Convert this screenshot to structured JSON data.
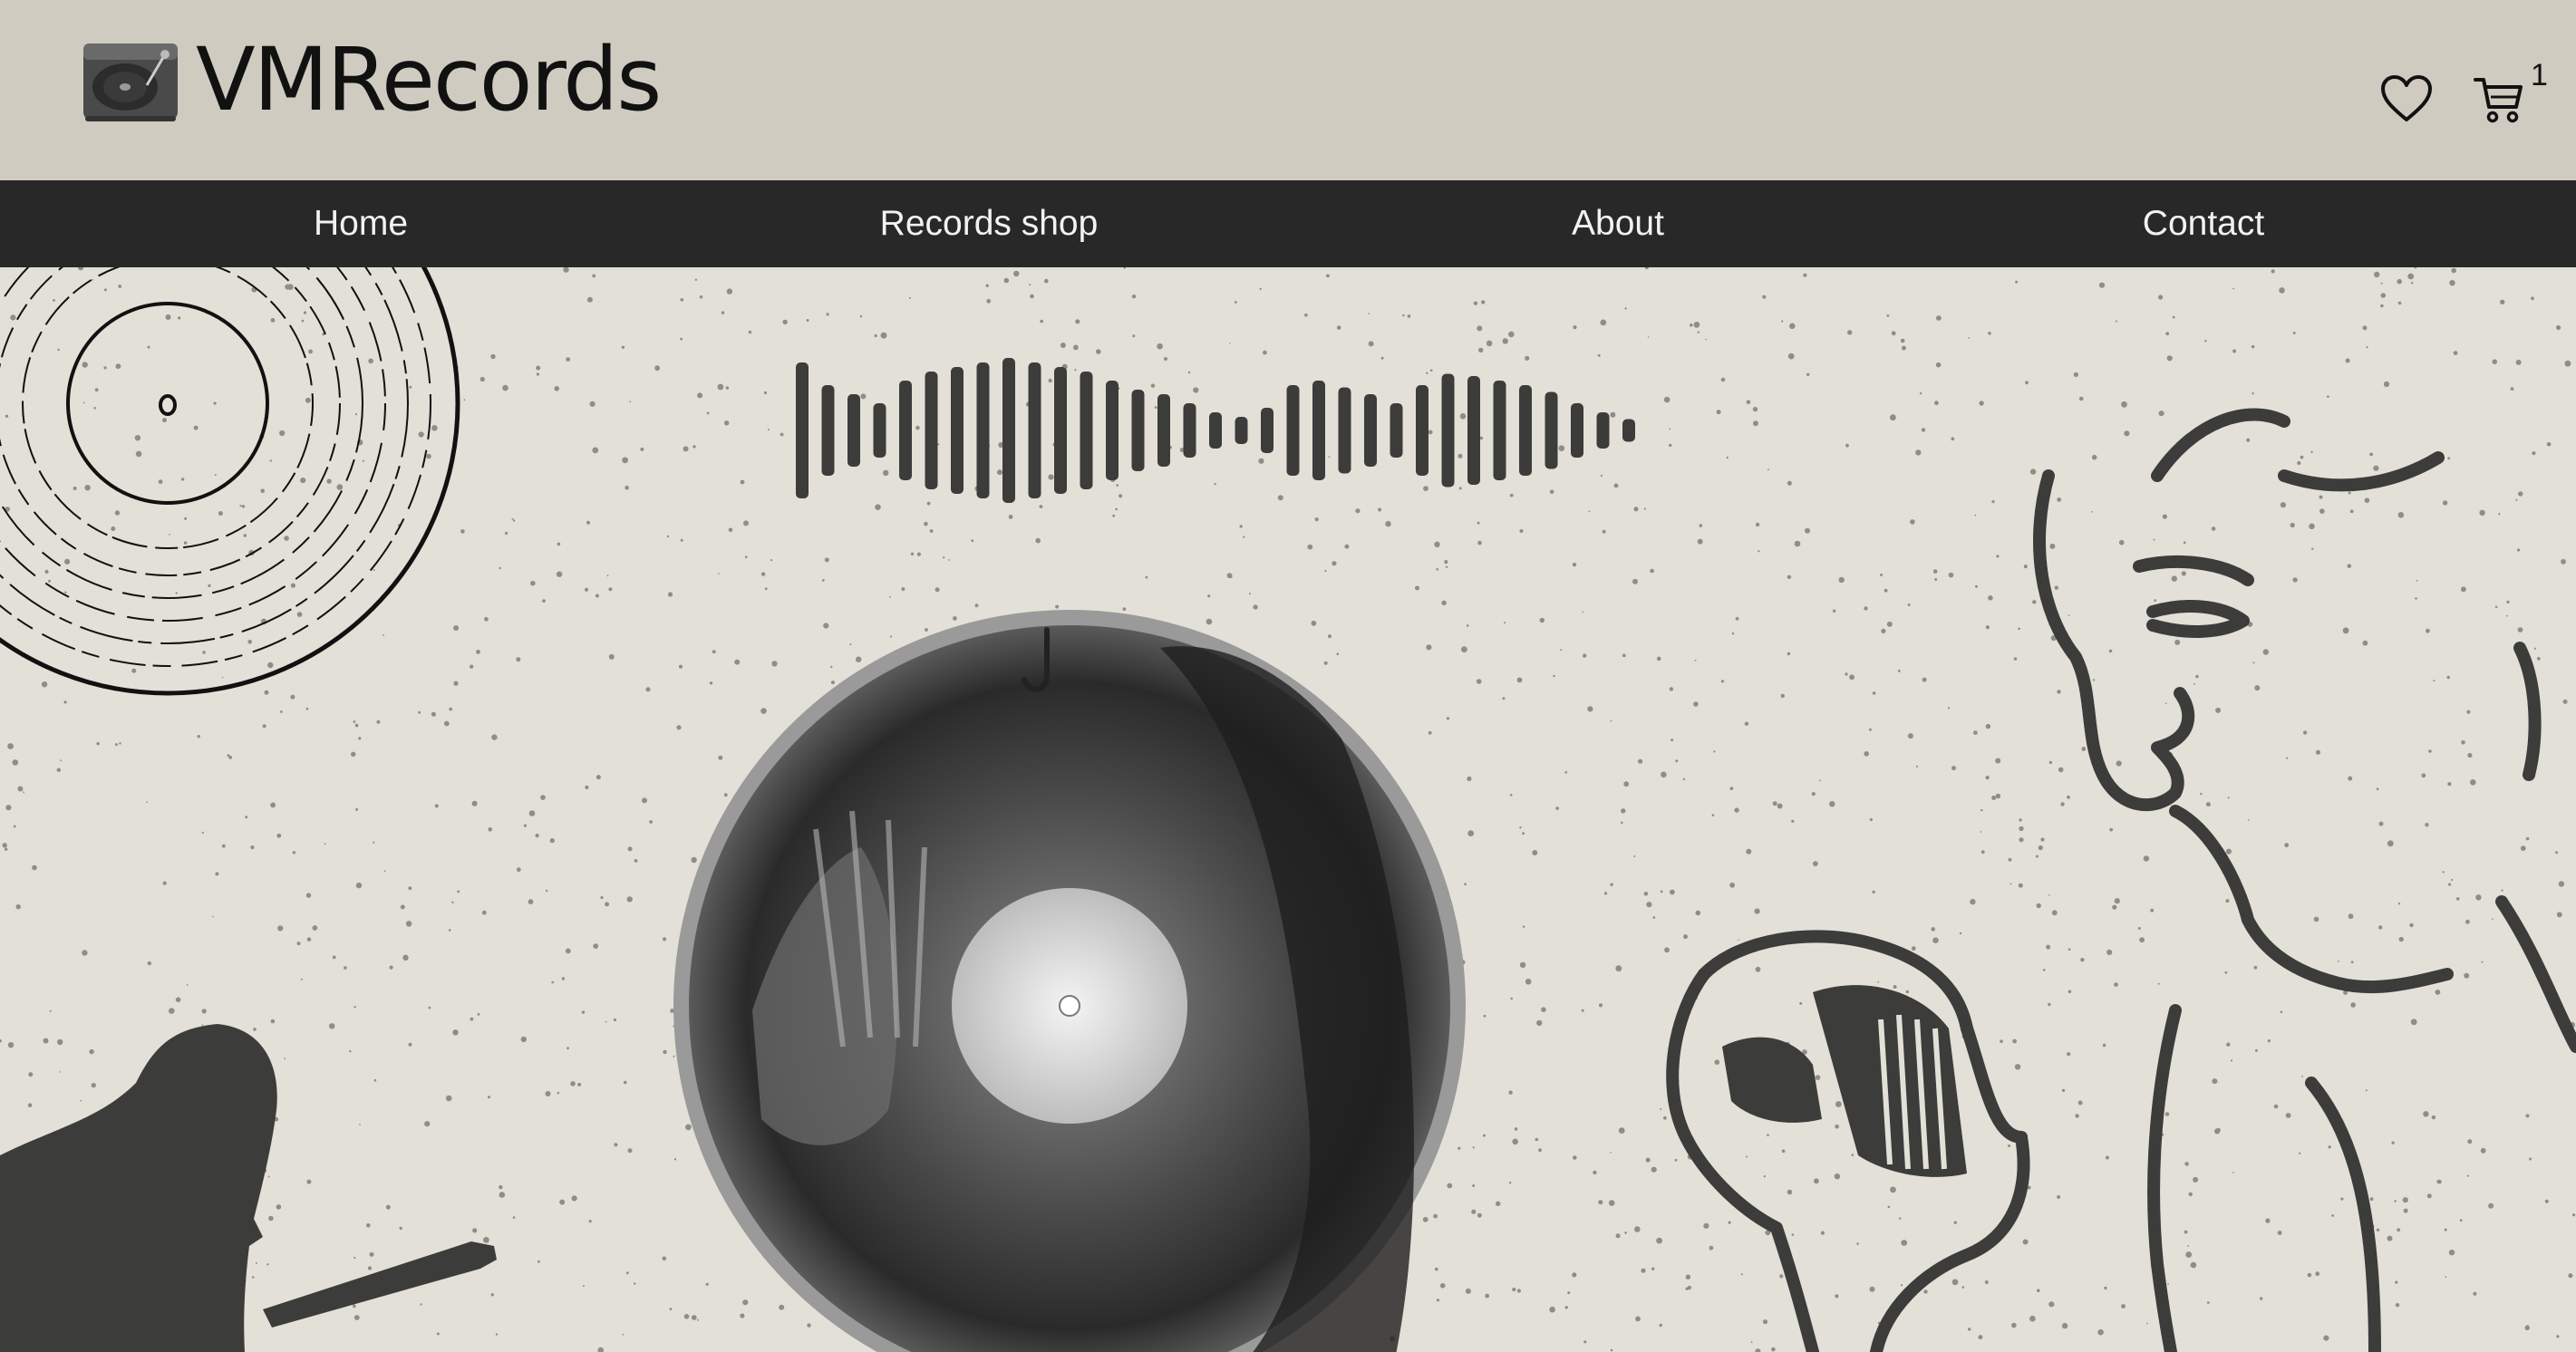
{
  "brand": {
    "name": "VMRecords",
    "logo_icon": "turntable-icon"
  },
  "header": {
    "wishlist_icon": "heart-icon",
    "cart_icon": "cart-icon",
    "cart_count": "1"
  },
  "nav": {
    "items": [
      {
        "label": "Home"
      },
      {
        "label": "Records shop"
      },
      {
        "label": "About"
      },
      {
        "label": "Contact"
      }
    ]
  },
  "colors": {
    "header_bg": "#cfcbc0",
    "nav_bg": "#282828",
    "nav_text": "#f2f2f2",
    "hero_bg": "#e3e0d8",
    "ink": "#3c3c3a"
  },
  "hero": {
    "artwork": [
      "vinyl-record-sketch",
      "sound-wave",
      "xray-vinyl-record",
      "guitarist-silhouette",
      "singer-with-microphone-sketch"
    ]
  }
}
